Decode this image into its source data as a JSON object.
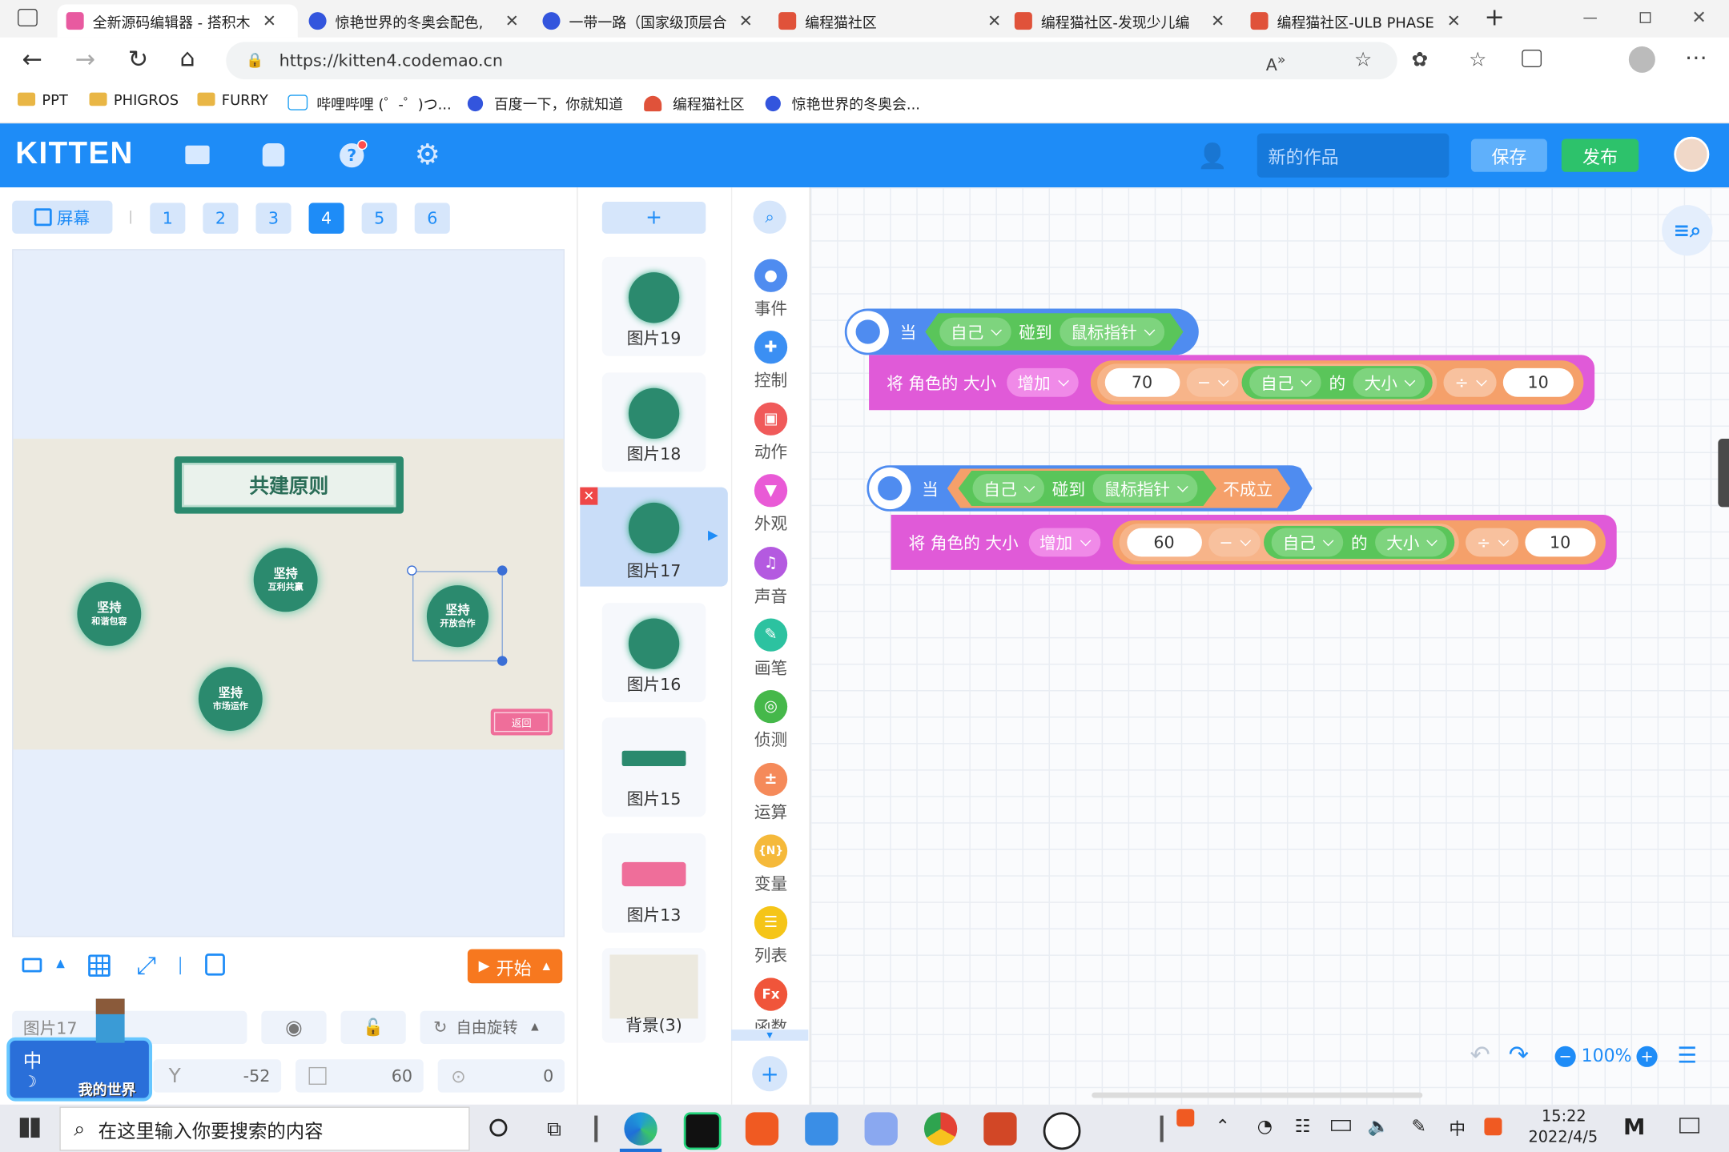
{
  "browser": {
    "tabs": [
      {
        "title": "全新源码编辑器 - 搭积木",
        "active": true,
        "color": "#e85aa0"
      },
      {
        "title": "惊艳世界的冬奥会配色,",
        "active": false,
        "color": "#3355dd"
      },
      {
        "title": "一带一路（国家级顶层合",
        "active": false,
        "color": "#3355dd"
      },
      {
        "title": "编程猫社区",
        "active": false,
        "color": "#e0523a"
      },
      {
        "title": "编程猫社区-发现少儿编",
        "active": false,
        "color": "#e0523a"
      },
      {
        "title": "编程猫社区-ULB PHASE",
        "active": false,
        "color": "#e0523a"
      }
    ],
    "url": "https://kitten4.codemao.cn",
    "bookmarks": [
      "PPT",
      "PHIGROS",
      "FURRY",
      "哔哩哔哩 (゜-゜)つ...",
      "百度一下，你就知道",
      "编程猫社区",
      "惊艳世界的冬奥会..."
    ]
  },
  "app": {
    "logo": "KITTEN",
    "project_name_placeholder": "新的作品",
    "save_label": "保存",
    "publish_label": "发布",
    "colors": {
      "primary": "#1e8cf7",
      "publish": "#2dc26b",
      "event": "#4f8cf0",
      "look": "#e05ad8",
      "sensing": "#5ac55a",
      "operator": "#f5a06a"
    }
  },
  "stage_panel": {
    "screen_label": "屏幕",
    "screens": [
      "1",
      "2",
      "3",
      "4",
      "5",
      "6"
    ],
    "active_screen": "4",
    "scene": {
      "title": "共建原则",
      "circles": [
        {
          "l1": "坚持",
          "l2": "和谐包容"
        },
        {
          "l1": "坚持",
          "l2": "互利共赢"
        },
        {
          "l1": "坚持",
          "l2": "开放合作"
        },
        {
          "l1": "坚持",
          "l2": "市场运作"
        }
      ],
      "back_label": "返回"
    },
    "start_label": "开始",
    "props": {
      "name": "图片17",
      "rotation_mode": "自由旋转",
      "y_label": "Y",
      "y": "-52",
      "size": "60",
      "direction": "0"
    },
    "ime": {
      "lang": "中",
      "game_logo": "我的世界"
    }
  },
  "sprites": {
    "add_label": "+",
    "items": [
      {
        "label": "图片19",
        "text": "坚持\n互利共赢"
      },
      {
        "label": "图片18",
        "text": "坚持\n市场运作"
      },
      {
        "label": "图片17",
        "text": "坚持\n开放合作",
        "selected": true
      },
      {
        "label": "图片16",
        "text": "坚持\n和谐包容"
      },
      {
        "label": "图片15",
        "text": "共建原则"
      },
      {
        "label": "图片13",
        "text": "返回"
      },
      {
        "label": "背景(3)",
        "text": ""
      }
    ]
  },
  "categories": [
    {
      "label": "事件",
      "icon": "event-icon",
      "color": "#4f8cf0"
    },
    {
      "label": "控制",
      "icon": "control-icon",
      "color": "#3b8ff3"
    },
    {
      "label": "动作",
      "icon": "motion-icon",
      "color": "#f05a5a"
    },
    {
      "label": "外观",
      "icon": "look-icon",
      "color": "#e95ad6"
    },
    {
      "label": "声音",
      "icon": "sound-icon",
      "color": "#b45ae0"
    },
    {
      "label": "画笔",
      "icon": "pen-icon",
      "color": "#2cc2a0"
    },
    {
      "label": "侦测",
      "icon": "sensing-icon",
      "color": "#45b84a"
    },
    {
      "label": "运算",
      "icon": "operator-icon",
      "color": "#f58a5a"
    },
    {
      "label": "变量",
      "icon": "variable-icon",
      "color": "#f5b93a"
    },
    {
      "label": "列表",
      "icon": "list-icon",
      "color": "#f5c518"
    },
    {
      "label": "函数",
      "icon": "function-icon",
      "color": "#f0553a"
    }
  ],
  "workspace": {
    "zoom": "100%",
    "script1": {
      "when": "当",
      "obj": "自己",
      "touch": "碰到",
      "target": "鼠标指针",
      "action": "将 角色的 大小",
      "mode": "增加",
      "num1": "70",
      "op1": "−",
      "obj2": "自己",
      "of": "的",
      "prop": "大小",
      "op2": "÷",
      "num2": "10"
    },
    "script2": {
      "when": "当",
      "obj": "自己",
      "touch": "碰到",
      "target": "鼠标指针",
      "not": "不成立",
      "action": "将 角色的 大小",
      "mode": "增加",
      "num1": "60",
      "op1": "−",
      "obj2": "自己",
      "of": "的",
      "prop": "大小",
      "op2": "÷",
      "num2": "10"
    }
  },
  "taskbar": {
    "search_placeholder": "在这里输入你要搜索的内容",
    "time": "15:22",
    "date": "2022/4/5",
    "ime": "中"
  }
}
